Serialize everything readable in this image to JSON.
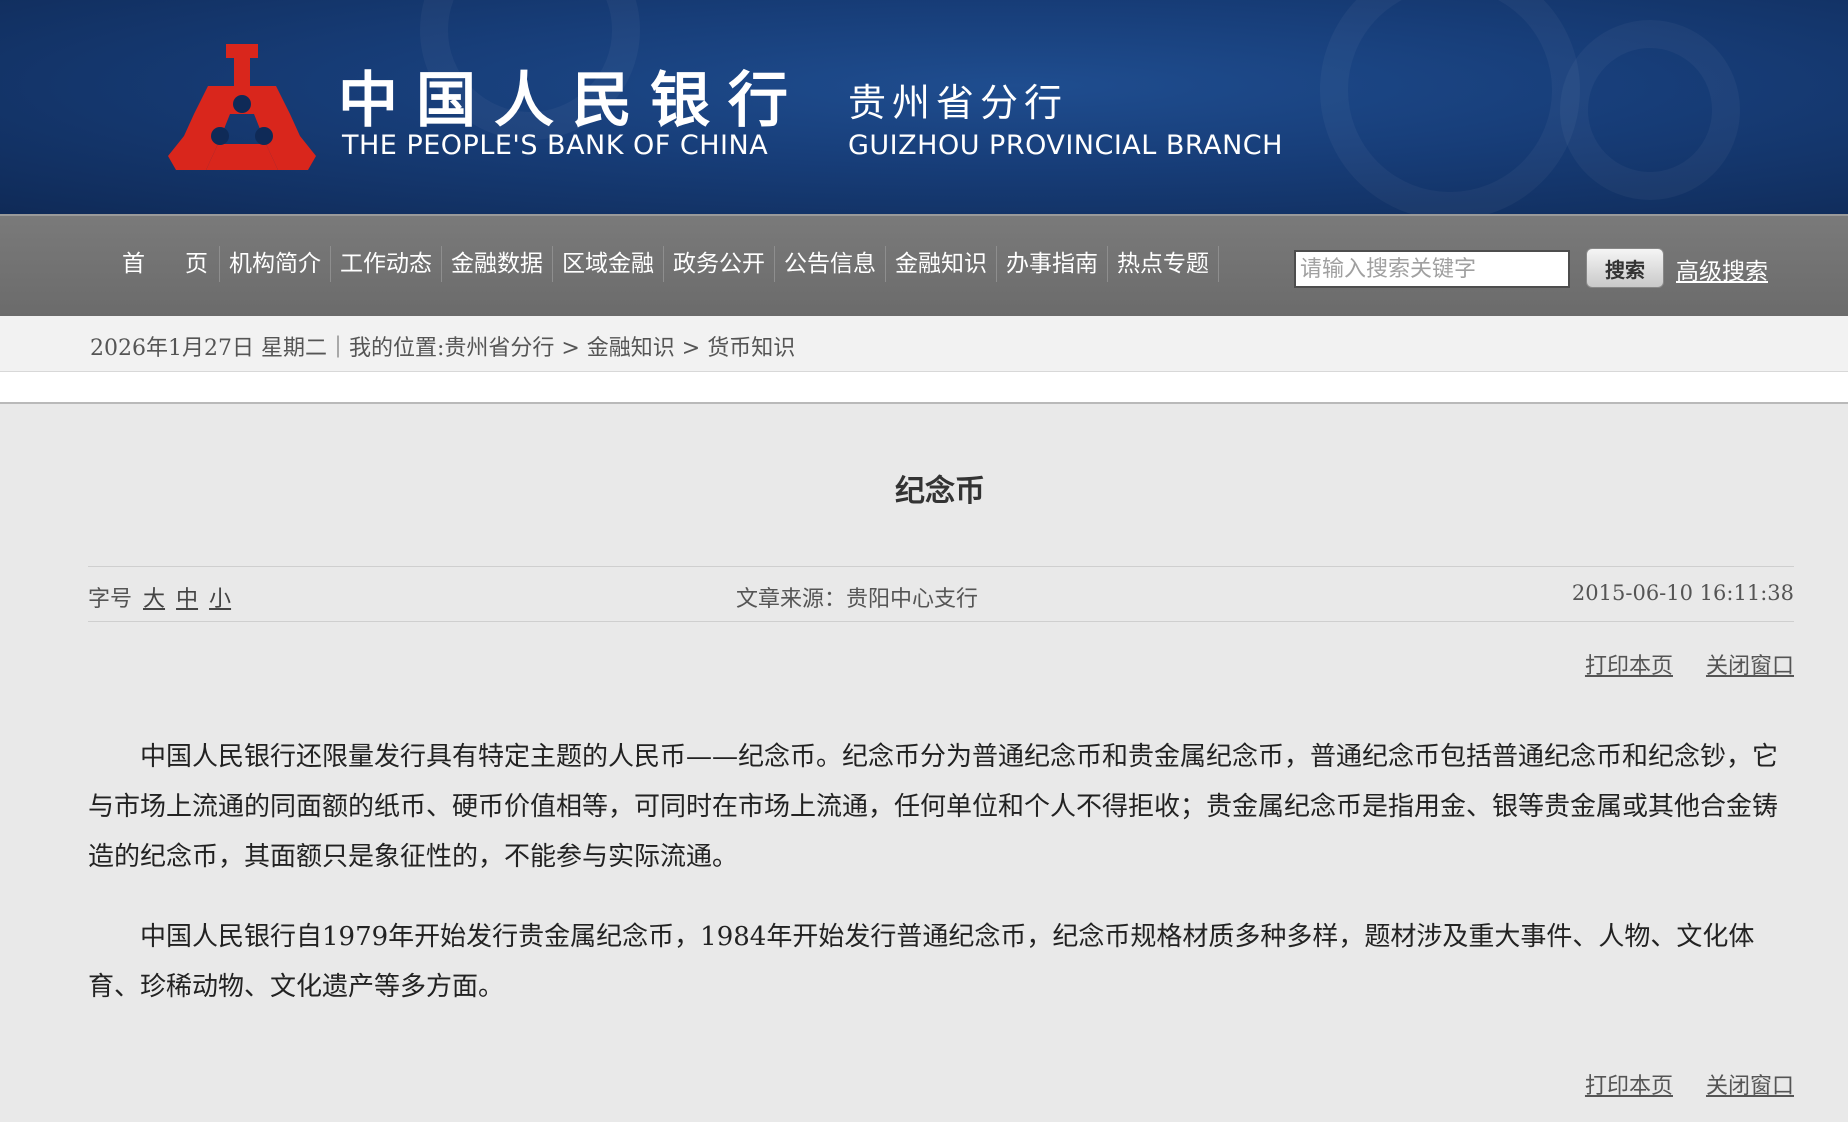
{
  "header": {
    "title_cn": "中国人民银行",
    "title_en": "THE PEOPLE'S BANK OF CHINA",
    "branch_cn": "贵州省分行",
    "branch_en": "GUIZHOU PROVINCIAL BRANCH",
    "logo_color": "#d9261c"
  },
  "nav": {
    "items": [
      {
        "label": "首页"
      },
      {
        "label": "机构简介"
      },
      {
        "label": "工作动态"
      },
      {
        "label": "金融数据"
      },
      {
        "label": "区域金融"
      },
      {
        "label": "政务公开"
      },
      {
        "label": "公告信息"
      },
      {
        "label": "金融知识"
      },
      {
        "label": "办事指南"
      },
      {
        "label": "热点专题"
      }
    ],
    "search_placeholder": "请输入搜索关键字",
    "search_button": "搜索",
    "advanced_search": "高级搜索"
  },
  "breadcrumb": {
    "text": "2026年1月27日 星期二｜我的位置:贵州省分行 > 金融知识 > 货币知识"
  },
  "article": {
    "title": "纪念币",
    "font_size_label": "字号",
    "font_sizes": [
      "大",
      "中",
      "小"
    ],
    "source": "文章来源：贵阳中心支行",
    "date": "2015-06-10 16:11:38",
    "print_label": "打印本页",
    "close_label": "关闭窗口",
    "paragraphs": [
      "中国人民银行还限量发行具有特定主题的人民币——纪念币。纪念币分为普通纪念币和贵金属纪念币，普通纪念币包括普通纪念币和纪念钞，它与市场上流通的同面额的纸币、硬币价值相等，可同时在市场上流通，任何单位和个人不得拒收；贵金属纪念币是指用金、银等贵金属或其他合金铸造的纪念币，其面额只是象征性的，不能参与实际流通。",
      "中国人民银行自1979年开始发行贵金属纪念币，1984年开始发行普通纪念币，纪念币规格材质多种多样，题材涉及重大事件、人物、文化体育、珍稀动物、文化遗产等多方面。"
    ]
  }
}
